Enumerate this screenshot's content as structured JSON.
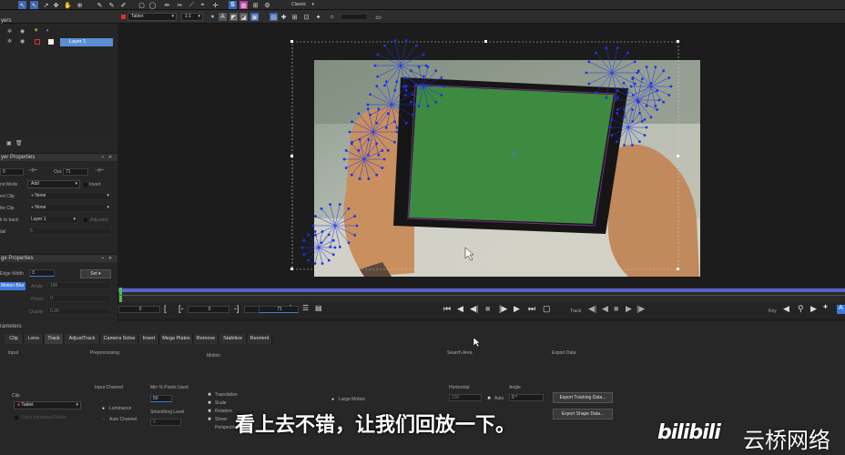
{
  "toolbar": {
    "workspace": "Classic"
  },
  "options": {
    "layer_combo": "Tablet",
    "zoom_combo": "1:1",
    "opacity_value": "0.5"
  },
  "layers_panel": {
    "title": "yers",
    "layer_name": "Layer 1"
  },
  "layer_properties": {
    "title": "yer Properties",
    "in_value": "0",
    "out_label": "Out",
    "out_value": "71",
    "blend_mode_label": "nd Mode",
    "blend_mode_value": "Add",
    "invert_label": "Invert",
    "insert_clip_label": "ert Clip",
    "insert_clip_value": "None",
    "matte_clip_label": "tte Clip",
    "matte_clip_value": "None",
    "link_track_label": "k to track",
    "link_track_value": "Layer 1",
    "adjusted_label": "Adjusted",
    "detail_label": "tail",
    "detail_value": "5"
  },
  "edge_properties": {
    "title": "ge Properties",
    "edge_width_label": "Edge Width",
    "edge_width_value": "3",
    "set_label": "Set",
    "motion_blur_label": "Motion Blur",
    "angle_label": "Angle",
    "angle_value": "180",
    "phase_label": "Phase",
    "phase_value": "0",
    "quality_label": "Quality",
    "quality_value": "0.26"
  },
  "parameters": {
    "title": "rameters",
    "tabs": [
      "Clip",
      "Lens",
      "Track",
      "AdjustTrack",
      "Camera Solve",
      "Insert",
      "Mega Plates",
      "Remove",
      "Stabilize",
      "Reorient"
    ],
    "input_label": "Input",
    "preprocessing_label": "Preprocessing",
    "motion_label": "Motion",
    "search_area_label": "Search Area",
    "export_data_label": "Export Data",
    "clip_label": "Clip",
    "clip_value": "Tablet",
    "track_ind_label": "Track Individual Fields",
    "input_channel_label": "Input Channel",
    "luminance_label": "Luminance",
    "auto_channel_label": "Auto Channel",
    "min_pixels_label": "Min % Pixels Used",
    "min_pixels_value": "50",
    "smoothing_label": "Smoothing Level",
    "smoothing_value": "0",
    "translation_label": "Translation",
    "scale_label": "Scale",
    "rotation_label": "Rotation",
    "shear_label": "Shear",
    "perspective_label": "Perspective",
    "large_motion_label": "Large Motion",
    "horizontal_label": "Horizontal",
    "horizontal_value": "200",
    "auto_label": "Auto",
    "angle_label": "Angle",
    "angle_value": "0 °",
    "export_tracking_label": "Export Tracking Data...",
    "export_shape_label": "Export Shape Data..."
  },
  "timeline": {
    "start_frame": "0",
    "in_frame": "0",
    "out_frame": "0",
    "current_frame": "71",
    "track_label": "Track",
    "key_label": "Key"
  },
  "subtitle": {
    "text": "看上去不错，让我们回放一下。",
    "brand": "云桥网络",
    "logo": "bilibili"
  },
  "colors": {
    "accent": "#3d7bd9",
    "selected_layer": "#5b8fd4",
    "tracker_dots": "#1c34e6",
    "green_screen": "#3d8a41"
  }
}
